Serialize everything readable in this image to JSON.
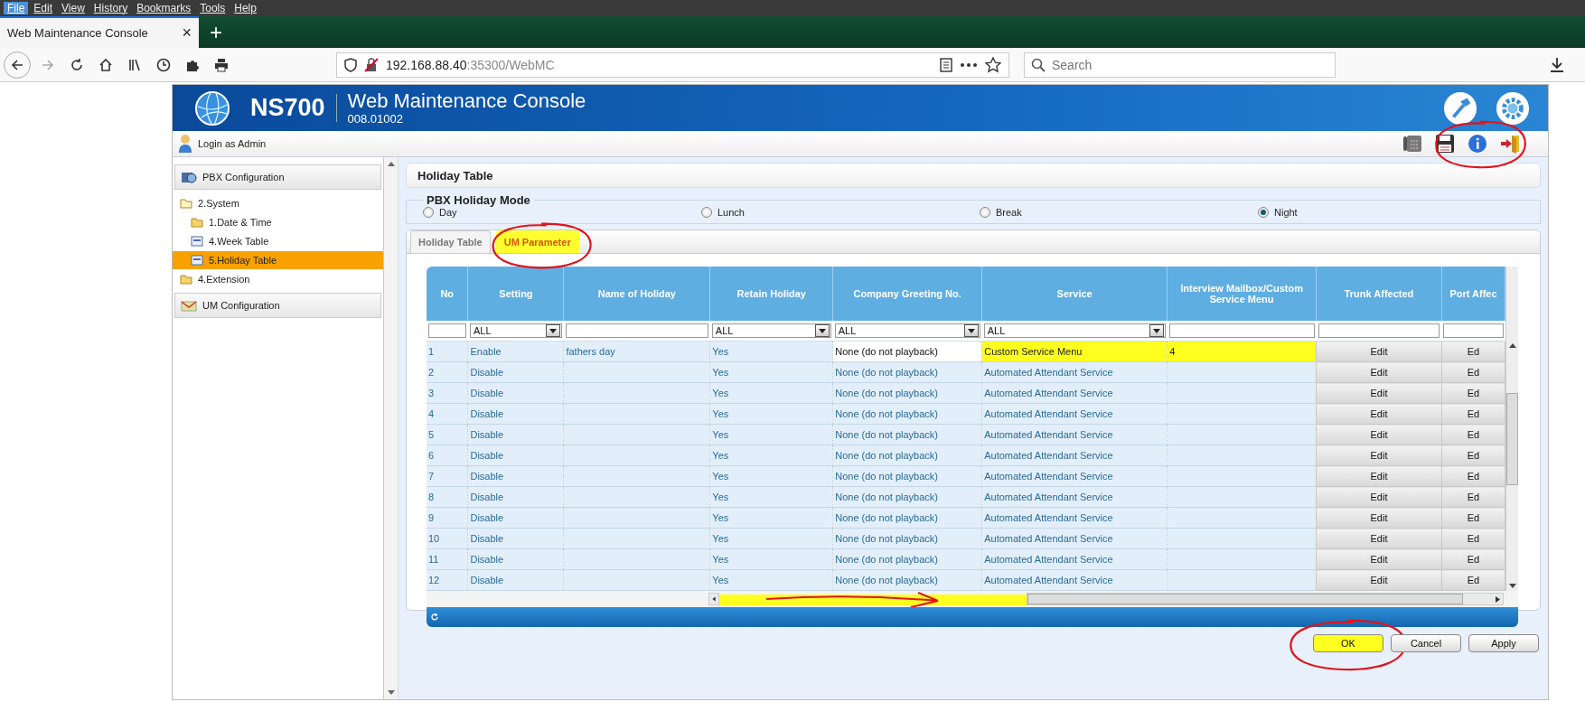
{
  "browser": {
    "menu": [
      {
        "label": "File",
        "selected": true
      },
      {
        "label": "Edit",
        "selected": false
      },
      {
        "label": "View",
        "selected": false
      },
      {
        "label": "History",
        "selected": false
      },
      {
        "label": "Bookmarks",
        "selected": false
      },
      {
        "label": "Tools",
        "selected": false
      },
      {
        "label": "Help",
        "selected": false
      }
    ],
    "tab": {
      "title": "Web Maintenance Console",
      "close": "×"
    },
    "new_tab": "+",
    "url_host": "192.168.88.40",
    "url_rest": ":35300/WebMC",
    "search": {
      "placeholder": "Search"
    }
  },
  "app": {
    "product": "NS700",
    "title": "Web Maintenance Console",
    "version": "008.01002",
    "login": "Login as Admin",
    "toolbar_circled": true
  },
  "sidebar": {
    "sections": [
      {
        "label": "PBX Configuration",
        "children": [
          {
            "label": "2.System",
            "kind": "folder",
            "expanded": true,
            "selected": false,
            "children": [
              {
                "label": "1.Date & Time",
                "kind": "folder",
                "selected": false
              },
              {
                "label": "4.Week Table",
                "kind": "page",
                "selected": false
              },
              {
                "label": "5.Holiday Table",
                "kind": "page",
                "selected": true
              }
            ]
          },
          {
            "label": "4.Extension",
            "kind": "folder",
            "expanded": false,
            "selected": false
          }
        ]
      },
      {
        "label": "UM Configuration"
      }
    ]
  },
  "page": {
    "title": "Holiday Table",
    "mode": {
      "legend": "PBX Holiday Mode",
      "options": [
        {
          "label": "Day",
          "selected": false
        },
        {
          "label": "Lunch",
          "selected": false
        },
        {
          "label": "Break",
          "selected": false
        },
        {
          "label": "Night",
          "selected": true
        }
      ]
    },
    "tabs": [
      {
        "label": "Holiday Table",
        "selected": false,
        "highlighted": false,
        "circled": false
      },
      {
        "label": "UM Parameter",
        "selected": true,
        "highlighted": true,
        "circled": true
      }
    ],
    "table": {
      "columns": [
        "No",
        "Setting",
        "Name of Holiday",
        "Retain Holiday",
        "Company Greeting No.",
        "Service",
        "Interview Mailbox/Custom Service Menu",
        "Trunk Affected",
        "Port Affec"
      ],
      "filters": [
        {
          "kind": "text"
        },
        {
          "kind": "select",
          "value": "ALL"
        },
        {
          "kind": "text"
        },
        {
          "kind": "select",
          "value": "ALL"
        },
        {
          "kind": "select",
          "value": "ALL"
        },
        {
          "kind": "select",
          "value": "ALL"
        },
        {
          "kind": "text"
        },
        {
          "kind": "text"
        },
        {
          "kind": "text"
        }
      ],
      "rows": [
        {
          "cells": [
            "1",
            "Enable",
            "fathers day",
            "Yes",
            "None (do not playback)",
            "Custom Service Menu",
            "4",
            "Edit",
            "Ed"
          ],
          "highlighted": true
        },
        {
          "cells": [
            "2",
            "Disable",
            "",
            "Yes",
            "None (do not playback)",
            "Automated Attendant Service",
            "",
            "Edit",
            "Ed"
          ],
          "highlighted": false
        },
        {
          "cells": [
            "3",
            "Disable",
            "",
            "Yes",
            "None (do not playback)",
            "Automated Attendant Service",
            "",
            "Edit",
            "Ed"
          ],
          "highlighted": false
        },
        {
          "cells": [
            "4",
            "Disable",
            "",
            "Yes",
            "None (do not playback)",
            "Automated Attendant Service",
            "",
            "Edit",
            "Ed"
          ],
          "highlighted": false
        },
        {
          "cells": [
            "5",
            "Disable",
            "",
            "Yes",
            "None (do not playback)",
            "Automated Attendant Service",
            "",
            "Edit",
            "Ed"
          ],
          "highlighted": false
        },
        {
          "cells": [
            "6",
            "Disable",
            "",
            "Yes",
            "None (do not playback)",
            "Automated Attendant Service",
            "",
            "Edit",
            "Ed"
          ],
          "highlighted": false
        },
        {
          "cells": [
            "7",
            "Disable",
            "",
            "Yes",
            "None (do not playback)",
            "Automated Attendant Service",
            "",
            "Edit",
            "Ed"
          ],
          "highlighted": false
        },
        {
          "cells": [
            "8",
            "Disable",
            "",
            "Yes",
            "None (do not playback)",
            "Automated Attendant Service",
            "",
            "Edit",
            "Ed"
          ],
          "highlighted": false
        },
        {
          "cells": [
            "9",
            "Disable",
            "",
            "Yes",
            "None (do not playback)",
            "Automated Attendant Service",
            "",
            "Edit",
            "Ed"
          ],
          "highlighted": false
        },
        {
          "cells": [
            "10",
            "Disable",
            "",
            "Yes",
            "None (do not playback)",
            "Automated Attendant Service",
            "",
            "Edit",
            "Ed"
          ],
          "highlighted": false
        },
        {
          "cells": [
            "11",
            "Disable",
            "",
            "Yes",
            "None (do not playback)",
            "Automated Attendant Service",
            "",
            "Edit",
            "Ed"
          ],
          "highlighted": false
        },
        {
          "cells": [
            "12",
            "Disable",
            "",
            "Yes",
            "None (do not playback)",
            "Automated Attendant Service",
            "",
            "Edit",
            "Ed"
          ],
          "highlighted": false
        }
      ],
      "hscroll": {
        "annotated": true
      }
    },
    "buttons": [
      {
        "label": "OK",
        "highlighted": true,
        "circled": true
      },
      {
        "label": "Cancel",
        "highlighted": false,
        "circled": false
      },
      {
        "label": "Apply",
        "highlighted": false,
        "circled": false
      }
    ]
  }
}
